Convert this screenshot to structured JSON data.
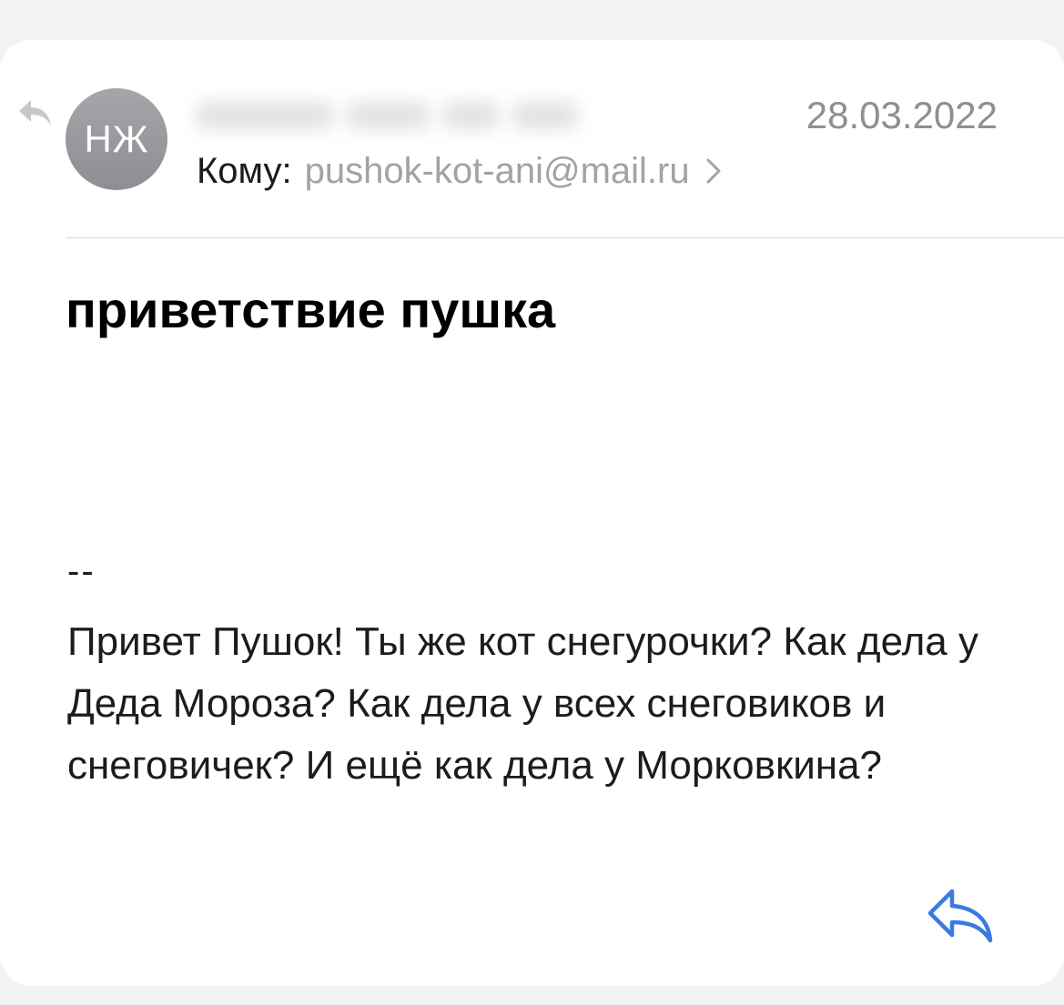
{
  "message": {
    "avatar_initials": "НЖ",
    "date": "28.03.2022",
    "to_label": "Кому:",
    "to_address": "pushok-kot-ani@mail.ru",
    "subject": "приветствие пушка",
    "signature_separator": "--",
    "body": "Привет Пушок! Ты же кот снегурочки? Как дела у Деда Мороза? Как дела у всех снеговиков и снеговичек? И ещё как дела у Морковкина?"
  },
  "icons": {
    "replied_indicator": "reply-arrow-icon",
    "recipient_chevron": "chevron-right-icon",
    "reply_action": "reply-icon"
  },
  "colors": {
    "accent": "#3a7be0",
    "secondary_text": "#8e8e93"
  }
}
